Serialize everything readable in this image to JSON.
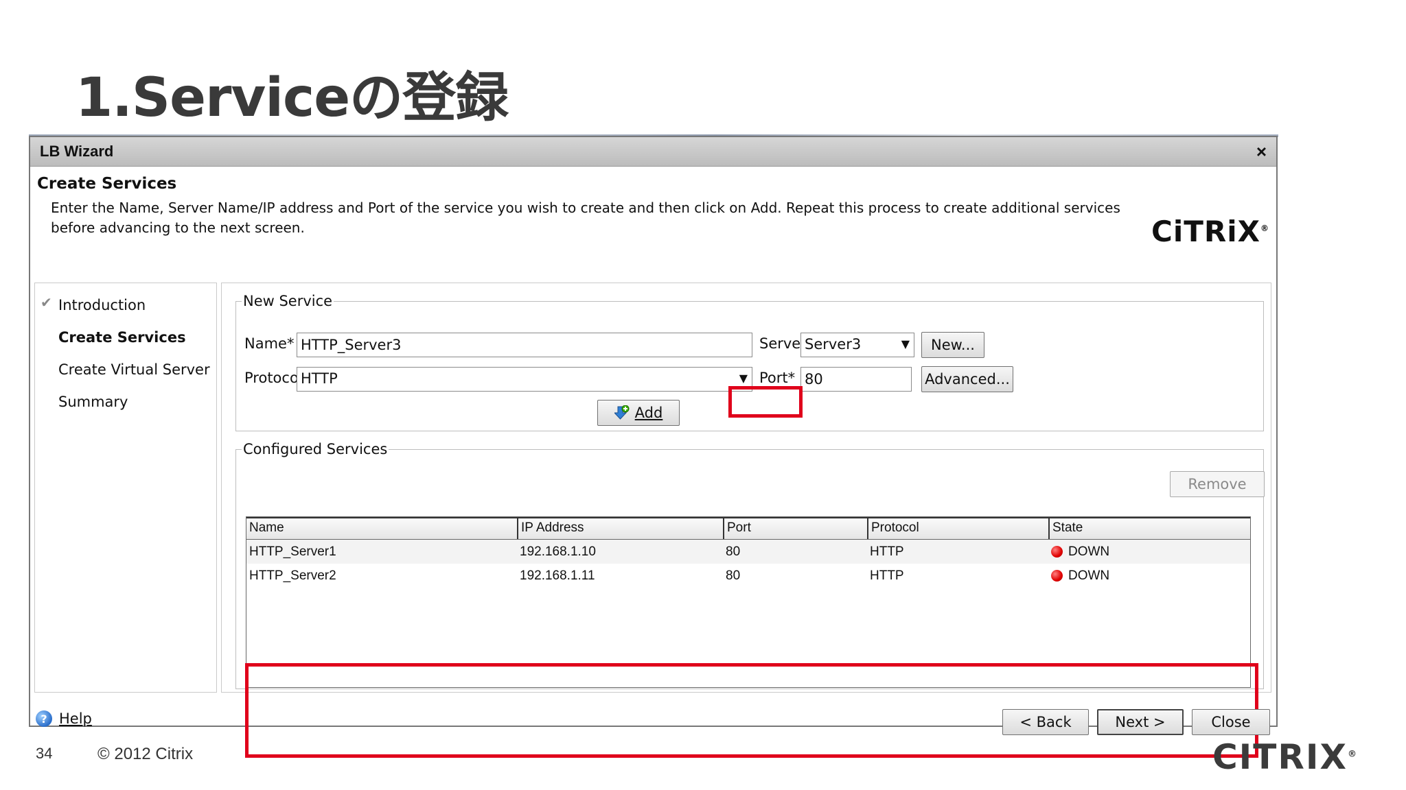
{
  "slide": {
    "title": "1.Serviceの登録",
    "page_number": "34",
    "copyright": "© 2012 Citrix",
    "footer_logo": "CITRIX",
    "trademark": "®"
  },
  "window": {
    "title": "LB Wizard",
    "close_glyph": "×",
    "heading": "Create Services",
    "description": "Enter the Name, Server Name/IP address and Port of the service you wish to create and then click on Add. Repeat this process to create additional services before advancing to the next screen.",
    "brand": "CiTRiX",
    "brand_mark": "®"
  },
  "sidebar": {
    "items": [
      {
        "label": "Introduction",
        "state": "done"
      },
      {
        "label": "Create Services",
        "state": "active"
      },
      {
        "label": "Create Virtual Server",
        "state": "pending"
      },
      {
        "label": "Summary",
        "state": "pending"
      }
    ],
    "check_glyph": "✔"
  },
  "new_service": {
    "legend": "New Service",
    "name_label": "Name*",
    "name_value": "HTTP_Server3",
    "server_label": "Server*",
    "server_value": "Server3",
    "new_button": "New...",
    "protocol_label": "Protocol*",
    "protocol_value": "HTTP",
    "port_label": "Port*",
    "port_value": "80",
    "advanced_button": "Advanced...",
    "add_button": "Add"
  },
  "configured_services": {
    "legend": "Configured Services",
    "remove_button": "Remove",
    "columns": [
      "Name",
      "IP Address",
      "Port",
      "Protocol",
      "State"
    ],
    "rows": [
      {
        "name": "HTTP_Server1",
        "ip": "192.168.1.10",
        "port": "80",
        "protocol": "HTTP",
        "state": "DOWN"
      },
      {
        "name": "HTTP_Server2",
        "ip": "192.168.1.11",
        "port": "80",
        "protocol": "HTTP",
        "state": "DOWN"
      }
    ]
  },
  "footer_buttons": {
    "help": "Help",
    "back": "< Back",
    "next": "Next >",
    "close": "Close"
  },
  "colors": {
    "highlight": "#e0001b",
    "status_down": "#e00000",
    "titlebar": "#c8c8c8"
  }
}
